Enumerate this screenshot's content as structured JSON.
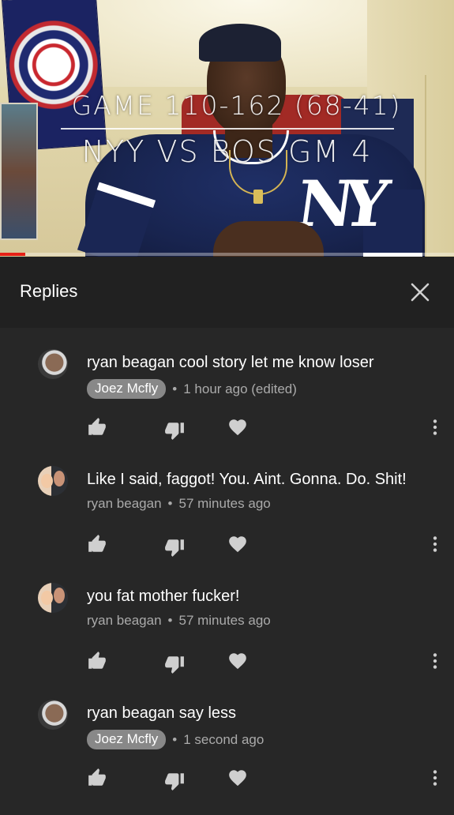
{
  "video": {
    "title_line1": "GAME 110-162 (68-41)",
    "title_line2": "NYY VS BOS GM 4",
    "jersey_logo": "NY",
    "progress_fraction": 0.055
  },
  "panel": {
    "title": "Replies",
    "close_icon": "close-icon"
  },
  "replies": [
    {
      "text": "ryan beagan cool story let me know loser",
      "author": "Joez Mcfly",
      "author_highlighted": true,
      "time": "1 hour ago (edited)"
    },
    {
      "text": "Like I said, faggot!  You. Aint. Gonna. Do. Shit!",
      "author": "ryan beagan",
      "author_highlighted": false,
      "time": "57 minutes ago"
    },
    {
      "text": "you fat mother fucker!",
      "author": "ryan beagan",
      "author_highlighted": false,
      "time": "57 minutes ago"
    },
    {
      "text": "ryan beagan say less",
      "author": "Joez Mcfly",
      "author_highlighted": true,
      "time": "1 second ago"
    }
  ],
  "icons": {
    "like": "thumbs-up-icon",
    "dislike": "thumbs-down-icon",
    "heart": "heart-icon",
    "more": "more-vert-icon"
  },
  "colors": {
    "panel_bg": "#272727",
    "header_bg": "#212121",
    "secondary_text": "#aaaaaa",
    "author_badge": "#888888",
    "progress_red": "#e62117"
  }
}
